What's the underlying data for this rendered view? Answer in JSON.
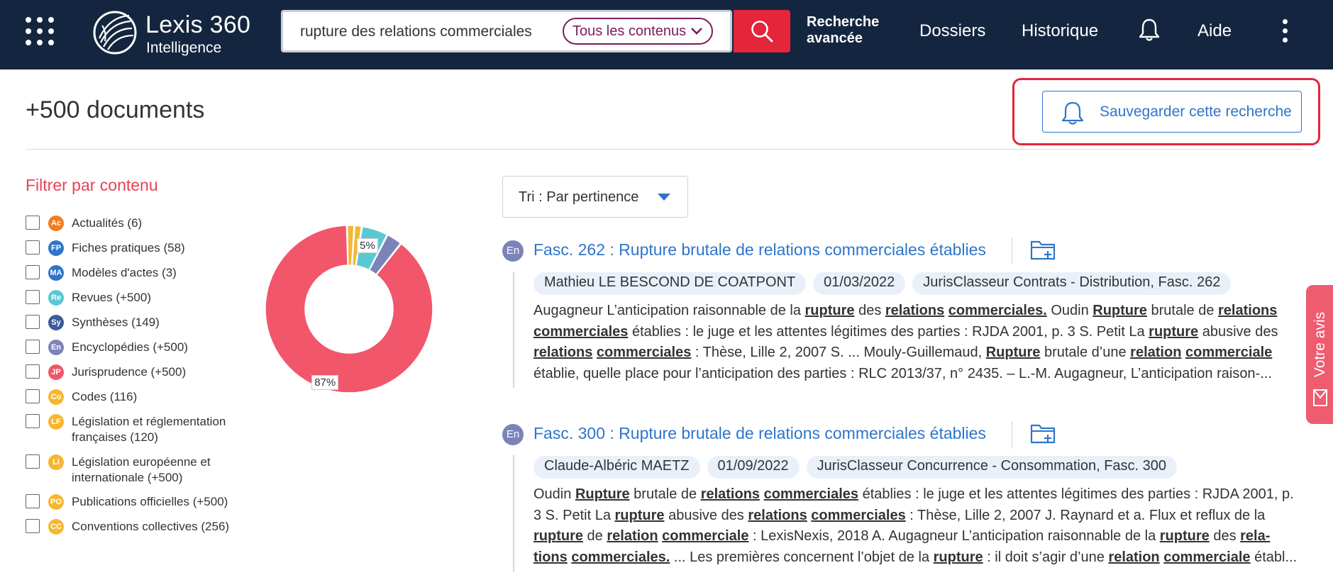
{
  "header": {
    "logo_brand": "Lexis 360",
    "logo_sub": "Intelligence",
    "search_value": "rupture des relations commerciales",
    "content_filter": "Tous les contenus",
    "nav": {
      "advanced_line1": "Recherche",
      "advanced_line2": "avancée",
      "folders": "Dossiers",
      "history": "Historique",
      "help": "Aide"
    }
  },
  "results_header": {
    "count": "+500 documents",
    "save_label": "Sauvegarder cette recherche"
  },
  "filters": {
    "title": "Filtrer par contenu",
    "items": [
      {
        "abbr": "Ac",
        "label": "Actualités (6)",
        "color": "#f07d20"
      },
      {
        "abbr": "FP",
        "label": "Fiches pratiques (58)",
        "color": "#2e75c9"
      },
      {
        "abbr": "MA",
        "label": "Modèles d'actes (3)",
        "color": "#2e75c9"
      },
      {
        "abbr": "Re",
        "label": "Revues (+500)",
        "color": "#5ac8d2"
      },
      {
        "abbr": "Sy",
        "label": "Synthèses (149)",
        "color": "#3b5a9a"
      },
      {
        "abbr": "En",
        "label": "Encyclopédies (+500)",
        "color": "#7c83b8"
      },
      {
        "abbr": "JP",
        "label": "Jurisprudence (+500)",
        "color": "#f2566b"
      },
      {
        "abbr": "Co",
        "label": "Codes (116)",
        "color": "#f5b731"
      },
      {
        "abbr": "LF",
        "label": "Législation et réglementation françaises (120)",
        "line1": "Législation et réglementation",
        "line2": "françaises (120)",
        "color": "#f5b731"
      },
      {
        "abbr": "LI",
        "label": "Législation européenne et internationale (+500)",
        "line1": "Législation européenne et",
        "line2": "internationale (+500)",
        "color": "#f5b731"
      },
      {
        "abbr": "PO",
        "label": "Publications officielles (+500)",
        "color": "#f5b731"
      },
      {
        "abbr": "CC",
        "label": "Conventions collectives (256)",
        "color": "#f5b731"
      }
    ]
  },
  "chart_data": {
    "type": "pie",
    "style": "donut",
    "slices": [
      {
        "category": "Jurisprudence",
        "value": 87,
        "color": "#f2566b"
      },
      {
        "category": "Codes",
        "value": 1.4,
        "color": "#f5b731"
      },
      {
        "category": "Législation",
        "value": 1.4,
        "color": "#f5b731"
      },
      {
        "category": "Revues",
        "value": 5,
        "color": "#5ac8d2"
      },
      {
        "category": "Encyclopédies",
        "value": 3,
        "color": "#7c83b8"
      }
    ],
    "labels": [
      {
        "slice": "Jurisprudence",
        "text": "87%"
      },
      {
        "slice": "Revues",
        "text": "5%"
      }
    ]
  },
  "sort": {
    "label": "Tri : Par pertinence"
  },
  "results": [
    {
      "type_badge": "En",
      "title": "Fasc. 262 : Rupture brutale de relations commerciales établies",
      "author": "Mathieu LE BESCOND DE COATPONT",
      "date": "01/03/2022",
      "source": "JurisClasseur Contrats - Distribution, Fasc. 262",
      "snippet": "Augagneur L’anticipation raisonnable de la [rupture] des [relations] [commerciales.] Oudin [Rupture] brutale de [relations] [commerciales] établies : le juge et les attentes légitimes des parties : RJDA 2001, p. 3 S. Petit La [rupture] abusive des [relations] [commerciales] : Thèse, Lille 2, 2007 S. ... Mouly-Guillemaud, [Rupture] brutale d’une [relation] [commerciale] établie, quelle place pour l’anticipation des parties : RLC 2013/37, n° 2435. – L.-M. Augagneur, L’anticipation raison-..."
    },
    {
      "type_badge": "En",
      "title": "Fasc. 300 : Rupture brutale de relations commerciales établies",
      "author": "Claude-Albéric MAETZ",
      "date": "01/09/2022",
      "source": "JurisClasseur Concurrence - Consommation, Fasc. 300",
      "snippet": "Oudin [Rupture] brutale de [relations] [commerciales] établies : le juge et les attentes légitimes des parties : RJDA 2001, p. 3 S. Petit La [rupture] abusive des [relations] [commerciales] : Thèse, Lille 2, 2007 J. Raynard et a. Flux et reflux de la [rupture] de [relation] [commerciale] : LexisNexis, 2018 A. Augagneur L’anticipation raisonnable de la [rupture] des [rela-] [tions] [commerciales.] ... Les premières concernent l’objet de la [rupture] : il doit s’agir d’une [relation] [commerciale] établ..."
    }
  ],
  "feedback": {
    "label": "Votre avis"
  },
  "colors": {
    "topbar": "#14263f",
    "accent_red": "#e4253a",
    "link_blue": "#2e75c9",
    "content_pill": "#7b1c5c",
    "filter_title": "#e84157"
  }
}
